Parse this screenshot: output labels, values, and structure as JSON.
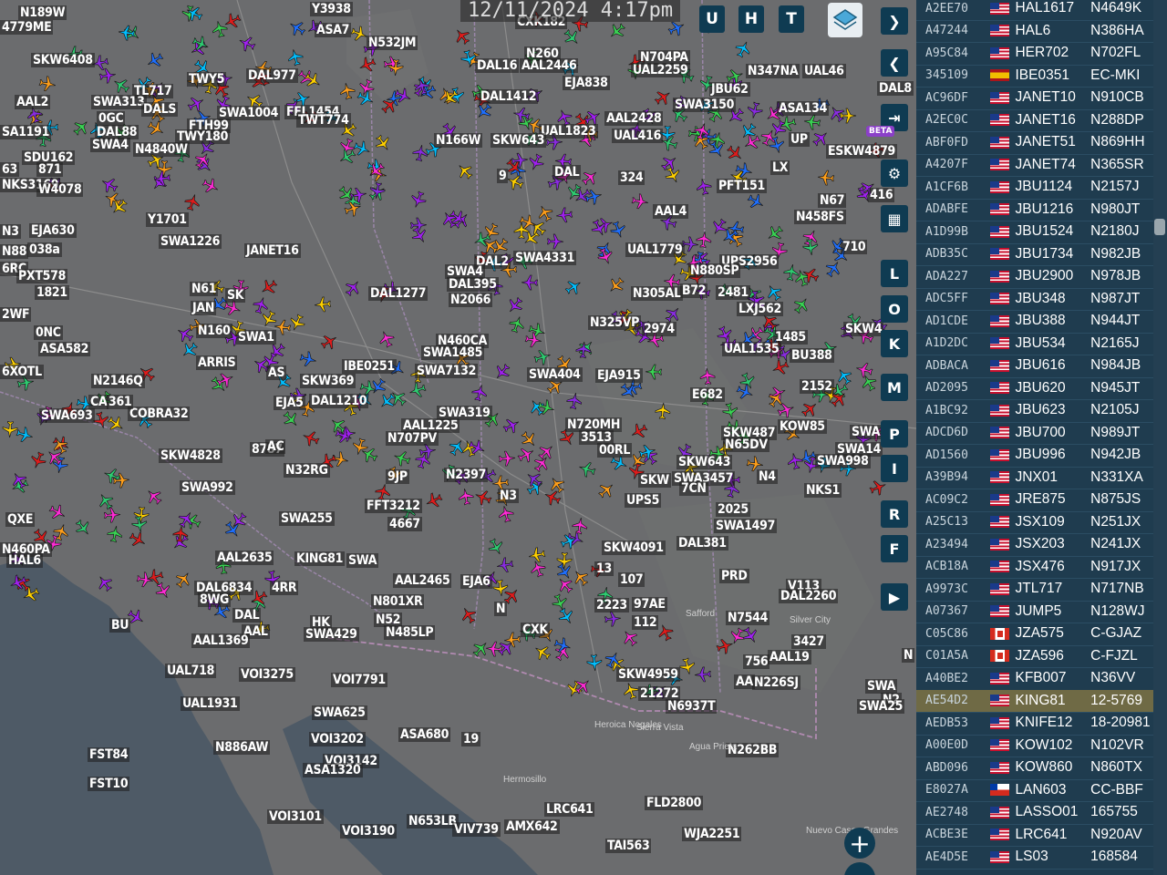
{
  "clock": "12/11/2024 4:17pm",
  "top_buttons": [
    "U",
    "H",
    "T"
  ],
  "side_buttons": [
    "L",
    "O",
    "K",
    "M",
    "P",
    "I",
    "R",
    "F"
  ],
  "beta_badge": "BETA",
  "zoom_in": "+",
  "colors": {
    "panel": "#1f3c4f",
    "button": "#0f3b52",
    "selected_row": "#6f6a45"
  },
  "map_places": [
    "Safford",
    "Silver City",
    "Heroica Nogales",
    "Sierra Vista",
    "Agua Prieta",
    "Hermosillo",
    "Nuevo Casas Grandes"
  ],
  "labels": [
    [
      "N189W",
      20,
      6
    ],
    [
      "4779ME",
      0,
      22
    ],
    [
      "SKW6408",
      34,
      58
    ],
    [
      "Y3938",
      340,
      2
    ],
    [
      "ASA7",
      345,
      25
    ],
    [
      "N532JM",
      402,
      39
    ],
    [
      "CXK182",
      565,
      16
    ],
    [
      "N260",
      575,
      51
    ],
    [
      "DAL16",
      521,
      64
    ],
    [
      "AAL2446",
      570,
      64
    ],
    [
      "N704PA",
      700,
      55
    ],
    [
      "UAL2259",
      692,
      69
    ],
    [
      "N347NA",
      818,
      70
    ],
    [
      "UAL46",
      880,
      70
    ],
    [
      "TWY5",
      205,
      79
    ],
    [
      "DAL977",
      270,
      75
    ],
    [
      "TL717",
      145,
      92
    ],
    [
      "EJA838",
      617,
      83
    ],
    [
      "JBU62",
      778,
      90
    ],
    [
      "SWA1004",
      238,
      116
    ],
    [
      "FFL1454",
      312,
      115
    ],
    [
      "TWT774",
      325,
      124
    ],
    [
      "DAL1412",
      525,
      98
    ],
    [
      "SWA3150",
      738,
      107
    ],
    [
      "ASA134",
      852,
      111
    ],
    [
      "DAL8",
      962,
      89
    ],
    [
      "SWA313",
      100,
      104
    ],
    [
      "AAL2",
      16,
      104
    ],
    [
      "DALS",
      155,
      112
    ],
    [
      "FTH99",
      205,
      130
    ],
    [
      "TWY180",
      192,
      142
    ],
    [
      "0GC",
      106,
      122
    ],
    [
      "DAL88",
      104,
      137
    ],
    [
      "SWA4",
      99,
      151
    ],
    [
      "N4840W",
      146,
      156
    ],
    [
      "SA1191",
      0,
      137
    ],
    [
      "AAL2428",
      663,
      122
    ],
    [
      "UAL1823",
      591,
      136
    ],
    [
      "UAL416",
      671,
      141
    ],
    [
      "N166W",
      476,
      146
    ],
    [
      "SKW643",
      538,
      146
    ],
    [
      "UP",
      865,
      145
    ],
    [
      "ESKW4879",
      906,
      158
    ],
    [
      "SDU162",
      24,
      165
    ],
    [
      "63",
      0,
      178
    ],
    [
      "871",
      40,
      178
    ],
    [
      "DAL",
      606,
      181
    ],
    [
      "324",
      678,
      187
    ],
    [
      "LX",
      845,
      176
    ],
    [
      "PFT151",
      786,
      196
    ],
    [
      "NKS3169",
      0,
      195
    ],
    [
      "W4078",
      40,
      200
    ],
    [
      "9",
      545,
      185
    ],
    [
      "AAL4",
      716,
      224
    ],
    [
      "N458FS",
      871,
      230
    ],
    [
      "N67",
      897,
      212
    ],
    [
      "416",
      952,
      206
    ],
    [
      "N3",
      0,
      246
    ],
    [
      "EJA630",
      32,
      245
    ],
    [
      "Y1701",
      160,
      233
    ],
    [
      "SWA1226",
      174,
      257
    ],
    [
      "JANET16",
      268,
      267
    ],
    [
      "UAL1779",
      686,
      266
    ],
    [
      "SWA4331",
      563,
      275
    ],
    [
      "UPS2956",
      789,
      279
    ],
    [
      "710",
      922,
      263
    ],
    [
      "N88",
      0,
      268
    ],
    [
      "038a",
      30,
      266
    ],
    [
      "6RC",
      0,
      287
    ],
    [
      "PXT578",
      18,
      295
    ],
    [
      "DAL2",
      520,
      279
    ],
    [
      "N880SP",
      755,
      289
    ],
    [
      "SWA4",
      488,
      290
    ],
    [
      "DAL395",
      490,
      304
    ],
    [
      "N2066",
      492,
      321
    ],
    [
      "1821",
      38,
      313
    ],
    [
      "N61",
      208,
      309
    ],
    [
      "SK",
      247,
      316
    ],
    [
      "DAL1277",
      404,
      314
    ],
    [
      "N305AL",
      692,
      314
    ],
    [
      "B72",
      746,
      311
    ],
    [
      "2481",
      785,
      313
    ],
    [
      "LXJ562",
      808,
      331
    ],
    [
      "2WF",
      0,
      337
    ],
    [
      "JAN",
      209,
      330
    ],
    [
      "N160",
      215,
      355
    ],
    [
      "SWA1",
      259,
      362
    ],
    [
      "N460CA",
      478,
      366
    ],
    [
      "SWA1485",
      462,
      379
    ],
    [
      "N325VP",
      645,
      346
    ],
    [
      "2974",
      704,
      353
    ],
    [
      "1485",
      848,
      362
    ],
    [
      "UAL1535",
      792,
      375
    ],
    [
      "SKW4",
      925,
      353
    ],
    [
      "0NC",
      37,
      357
    ],
    [
      "ASA582",
      42,
      375
    ],
    [
      "ARRIS",
      215,
      390
    ],
    [
      "AS",
      292,
      401
    ],
    [
      "IBE0251",
      375,
      394
    ],
    [
      "SWA7132",
      455,
      399
    ],
    [
      "SWA404",
      578,
      403
    ],
    [
      "EJA915",
      653,
      404
    ],
    [
      "BU388",
      866,
      382
    ],
    [
      "N2146Q",
      100,
      410
    ],
    [
      "SKW369",
      329,
      410
    ],
    [
      "E682",
      757,
      425
    ],
    [
      "2152",
      877,
      416
    ],
    [
      "6XOTL",
      0,
      400
    ],
    [
      "DAL1210",
      339,
      432
    ],
    [
      "EJA5",
      300,
      434
    ],
    [
      "AAL1225",
      440,
      459
    ],
    [
      "SWA319",
      479,
      445
    ],
    [
      "N720MH",
      620,
      458
    ],
    [
      "KOW85",
      853,
      460
    ],
    [
      "SWA",
      932,
      466
    ],
    [
      "N707PV",
      423,
      473
    ],
    [
      "3513",
      635,
      472
    ],
    [
      "SKW487",
      791,
      467
    ],
    [
      "N65DV",
      793,
      480
    ],
    [
      "SWA14",
      916,
      485
    ],
    [
      "COBRA32",
      140,
      446
    ],
    [
      "SWA693",
      43,
      448
    ],
    [
      "CA",
      97,
      433
    ],
    [
      "361",
      117,
      433
    ],
    [
      "8787",
      274,
      485
    ],
    [
      "AC",
      291,
      482
    ],
    [
      "SWA998",
      894,
      498
    ],
    [
      "SKW4828",
      174,
      492
    ],
    [
      "00RL",
      655,
      486
    ],
    [
      "SKW643",
      742,
      499
    ],
    [
      "N2397",
      487,
      513
    ],
    [
      "SKW",
      700,
      519
    ],
    [
      "SWA3457",
      737,
      517
    ],
    [
      "N4",
      830,
      515
    ],
    [
      "NKS1",
      882,
      530
    ],
    [
      "SWA992",
      197,
      527
    ],
    [
      "N32RG",
      311,
      508
    ],
    [
      "9JP",
      423,
      515
    ],
    [
      "N3",
      546,
      536
    ],
    [
      "FFT3212",
      400,
      547
    ],
    [
      "UPS5",
      685,
      541
    ],
    [
      "7CN",
      745,
      528
    ],
    [
      "2025",
      785,
      551
    ],
    [
      "SWA255",
      306,
      561
    ],
    [
      "4667",
      425,
      567
    ],
    [
      "SWA1497",
      783,
      569
    ],
    [
      "QXE",
      6,
      562
    ],
    [
      "N460PA",
      0,
      595
    ],
    [
      "HAL6",
      7,
      607
    ],
    [
      "SKW4091",
      660,
      593
    ],
    [
      "DAL381",
      742,
      588
    ],
    [
      "AAL2635",
      236,
      604
    ],
    [
      "KING81",
      323,
      605
    ],
    [
      "SWA",
      380,
      607
    ],
    [
      "AAL2465",
      431,
      629
    ],
    [
      "EJA6",
      505,
      630
    ],
    [
      "13",
      652,
      616
    ],
    [
      "107",
      678,
      628
    ],
    [
      "PRD",
      789,
      624
    ],
    [
      "V113",
      862,
      635
    ],
    [
      "DAL2260",
      854,
      646
    ],
    [
      "N801XR",
      407,
      652
    ],
    [
      "DAL6834",
      213,
      637
    ],
    [
      "4RR",
      296,
      637
    ],
    [
      "8WG",
      217,
      650
    ],
    [
      "2223",
      652,
      656
    ],
    [
      "97AE",
      693,
      655
    ],
    [
      "N",
      542,
      660
    ],
    [
      "N7544",
      796,
      670
    ],
    [
      "HK",
      340,
      675
    ],
    [
      "N52",
      410,
      672
    ],
    [
      "112",
      693,
      675
    ],
    [
      "DAL",
      255,
      667
    ],
    [
      "AAL",
      265,
      685
    ],
    [
      "SWA429",
      333,
      688
    ],
    [
      "N485LP",
      421,
      686
    ],
    [
      "AAL1369",
      210,
      695
    ],
    [
      "CXK",
      571,
      683
    ],
    [
      "BU",
      120,
      678
    ],
    [
      "3427",
      868,
      696
    ],
    [
      "AAL19",
      842,
      713
    ],
    [
      "N",
      989,
      711
    ],
    [
      "SKW4959",
      676,
      732
    ],
    [
      "N226SJ",
      825,
      741
    ],
    [
      "AA",
      805,
      740
    ],
    [
      "756",
      815,
      718
    ],
    [
      "UAL718",
      181,
      728
    ],
    [
      "VOI3275",
      262,
      732
    ],
    [
      "VOI7791",
      363,
      738
    ],
    [
      "21272",
      700,
      753
    ],
    [
      "SWA",
      949,
      745
    ],
    [
      "N6937T",
      730,
      767
    ],
    [
      "UAL1931",
      198,
      764
    ],
    [
      "N2",
      966,
      760
    ],
    [
      "SWA25",
      940,
      767
    ],
    [
      "SWA625",
      342,
      774
    ],
    [
      "ASA680",
      437,
      798
    ],
    [
      "19",
      506,
      803
    ],
    [
      "VOI3202",
      339,
      803
    ],
    [
      "FST84",
      96,
      820
    ],
    [
      "N886AW",
      234,
      812
    ],
    [
      "N262BB",
      796,
      815
    ],
    [
      "VOI3142",
      354,
      827
    ],
    [
      "ASA1320",
      332,
      837
    ],
    [
      "FST10",
      96,
      852
    ],
    [
      "FLD2800",
      707,
      873
    ],
    [
      "LRC641",
      597,
      880
    ],
    [
      "VOI3101",
      293,
      888
    ],
    [
      "N653LB",
      446,
      893
    ],
    [
      "VIV739",
      496,
      902
    ],
    [
      "AMX642",
      553,
      899
    ],
    [
      "VOI3190",
      373,
      904
    ],
    [
      "WJA2251",
      748,
      907
    ],
    [
      "TAI563",
      664,
      920
    ]
  ],
  "aircraft_list": [
    {
      "hex": "A2EE70",
      "callsign": "HAL1617",
      "reg": "N4649K",
      "flag": "US"
    },
    {
      "hex": "A47244",
      "callsign": "HAL6",
      "reg": "N386HA",
      "flag": "US"
    },
    {
      "hex": "A95C84",
      "callsign": "HER702",
      "reg": "N702FL",
      "flag": "US"
    },
    {
      "hex": "345109",
      "callsign": "IBE0351",
      "reg": "EC-MKI",
      "flag": "ES"
    },
    {
      "hex": "AC96DF",
      "callsign": "JANET10",
      "reg": "N910CB",
      "flag": "US"
    },
    {
      "hex": "A2EC0C",
      "callsign": "JANET16",
      "reg": "N288DP",
      "flag": "US"
    },
    {
      "hex": "ABF0FD",
      "callsign": "JANET51",
      "reg": "N869HH",
      "flag": "US"
    },
    {
      "hex": "A4207F",
      "callsign": "JANET74",
      "reg": "N365SR",
      "flag": "US"
    },
    {
      "hex": "A1CF6B",
      "callsign": "JBU1124",
      "reg": "N2157J",
      "flag": "US"
    },
    {
      "hex": "ADABFE",
      "callsign": "JBU1216",
      "reg": "N980JT",
      "flag": "US"
    },
    {
      "hex": "A1D99B",
      "callsign": "JBU1524",
      "reg": "N2180J",
      "flag": "US"
    },
    {
      "hex": "ADB35C",
      "callsign": "JBU1734",
      "reg": "N982JB",
      "flag": "US"
    },
    {
      "hex": "ADA227",
      "callsign": "JBU2900",
      "reg": "N978JB",
      "flag": "US"
    },
    {
      "hex": "ADC5FF",
      "callsign": "JBU348",
      "reg": "N987JT",
      "flag": "US"
    },
    {
      "hex": "AD1CDE",
      "callsign": "JBU388",
      "reg": "N944JT",
      "flag": "US"
    },
    {
      "hex": "A1D2DC",
      "callsign": "JBU534",
      "reg": "N2165J",
      "flag": "US"
    },
    {
      "hex": "ADBACA",
      "callsign": "JBU616",
      "reg": "N984JB",
      "flag": "US"
    },
    {
      "hex": "AD2095",
      "callsign": "JBU620",
      "reg": "N945JT",
      "flag": "US"
    },
    {
      "hex": "A1BC92",
      "callsign": "JBU623",
      "reg": "N2105J",
      "flag": "US"
    },
    {
      "hex": "ADCD6D",
      "callsign": "JBU700",
      "reg": "N989JT",
      "flag": "US"
    },
    {
      "hex": "AD1560",
      "callsign": "JBU996",
      "reg": "N942JB",
      "flag": "US"
    },
    {
      "hex": "A39B94",
      "callsign": "JNX01",
      "reg": "N331XA",
      "flag": "US"
    },
    {
      "hex": "AC09C2",
      "callsign": "JRE875",
      "reg": "N875JS",
      "flag": "US"
    },
    {
      "hex": "A25C13",
      "callsign": "JSX109",
      "reg": "N251JX",
      "flag": "US"
    },
    {
      "hex": "A23494",
      "callsign": "JSX203",
      "reg": "N241JX",
      "flag": "US"
    },
    {
      "hex": "ACB18A",
      "callsign": "JSX476",
      "reg": "N917JX",
      "flag": "US"
    },
    {
      "hex": "A9973C",
      "callsign": "JTL717",
      "reg": "N717NB",
      "flag": "US"
    },
    {
      "hex": "A07367",
      "callsign": "JUMP5",
      "reg": "N128WJ",
      "flag": "US"
    },
    {
      "hex": "C05C86",
      "callsign": "JZA575",
      "reg": "C-GJAZ",
      "flag": "CA"
    },
    {
      "hex": "C01A5A",
      "callsign": "JZA596",
      "reg": "C-FJZL",
      "flag": "CA"
    },
    {
      "hex": "A40BE2",
      "callsign": "KFB007",
      "reg": "N36VV",
      "flag": "US"
    },
    {
      "hex": "AE54D2",
      "callsign": "KING81",
      "reg": "12-5769",
      "flag": "US",
      "selected": true
    },
    {
      "hex": "AEDB53",
      "callsign": "KNIFE12",
      "reg": "18-20981",
      "flag": "US"
    },
    {
      "hex": "A00E0D",
      "callsign": "KOW102",
      "reg": "N102VR",
      "flag": "US"
    },
    {
      "hex": "ABD096",
      "callsign": "KOW860",
      "reg": "N860TX",
      "flag": "US"
    },
    {
      "hex": "E8027A",
      "callsign": "LAN603",
      "reg": "CC-BBF",
      "flag": "CL"
    },
    {
      "hex": "AE2748",
      "callsign": "LASSO01",
      "reg": "165755",
      "flag": "US"
    },
    {
      "hex": "ACBE3E",
      "callsign": "LRC641",
      "reg": "N920AV",
      "flag": "US"
    },
    {
      "hex": "AE4D5E",
      "callsign": "LS03",
      "reg": "168584",
      "flag": "US"
    }
  ]
}
